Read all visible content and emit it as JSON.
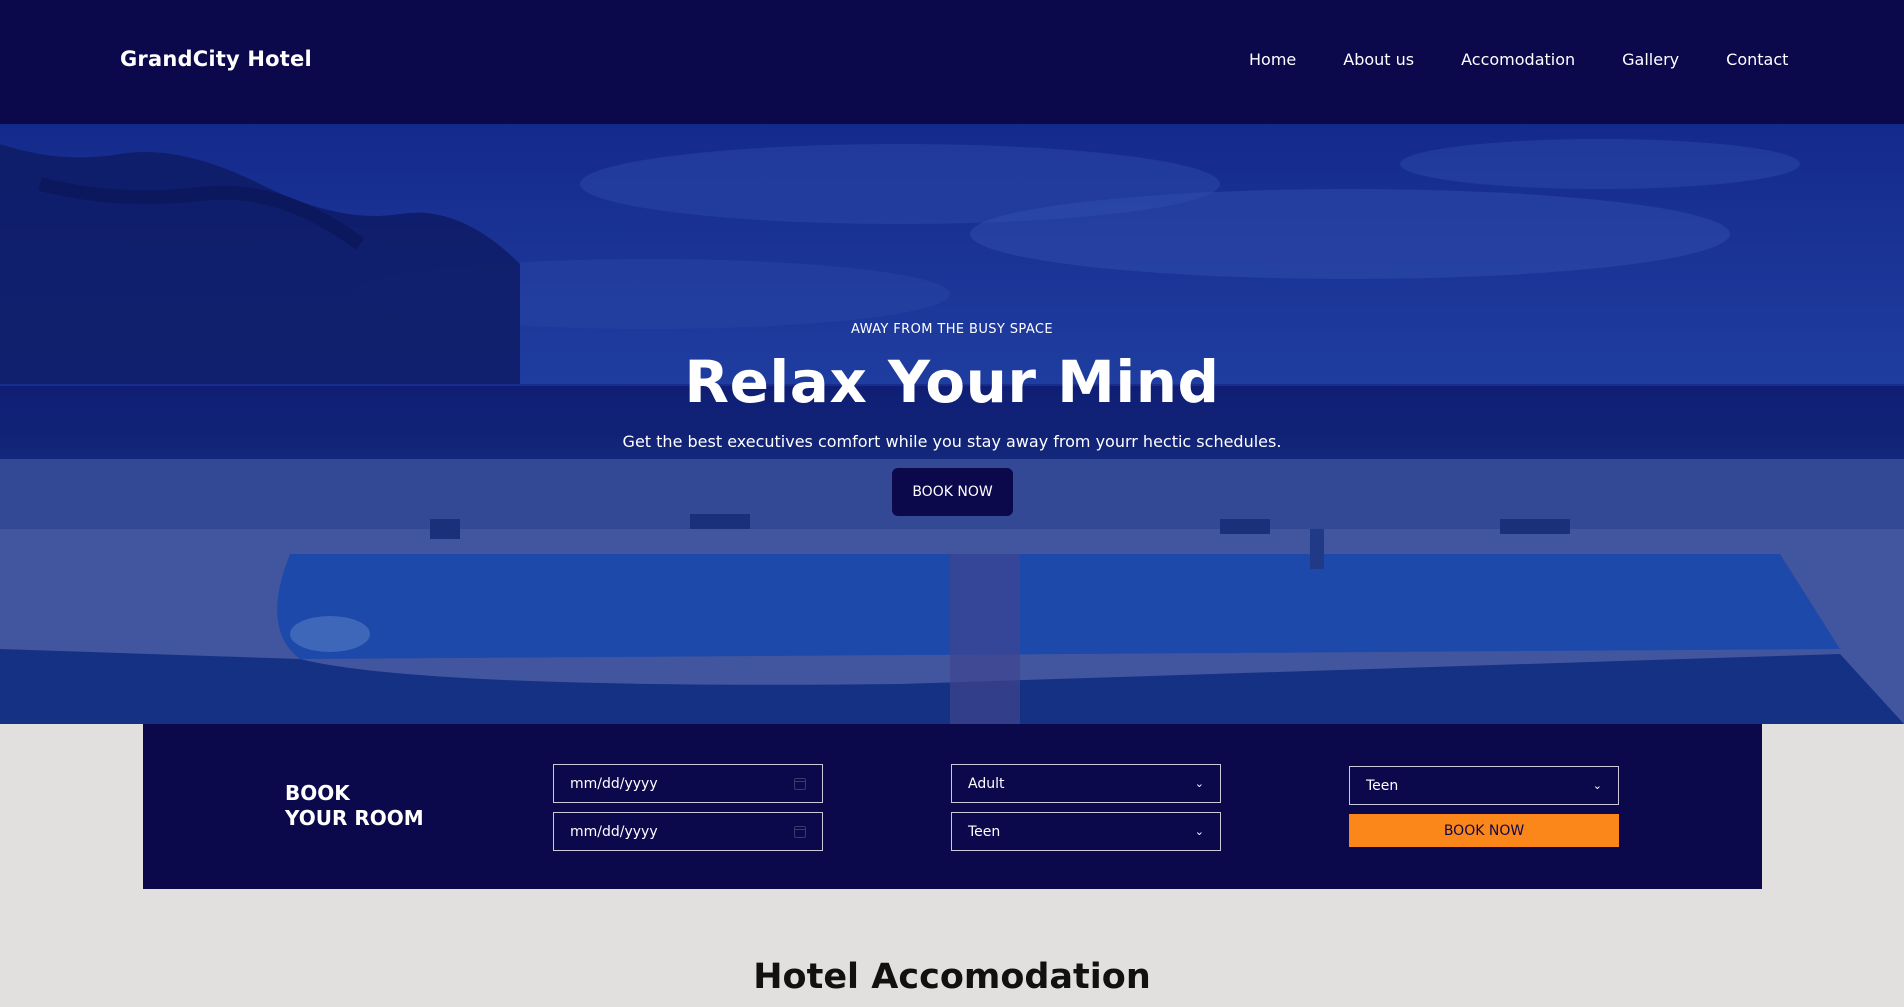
{
  "nav": {
    "brand": "GrandCity Hotel",
    "links": [
      "Home",
      "About us",
      "Accomodation",
      "Gallery",
      "Contact"
    ]
  },
  "hero": {
    "eyebrow": "AWAY FROM THE BUSY SPACE",
    "title": "Relax Your Mind",
    "subtitle": "Get the best executives comfort while you stay away from yourr hectic schedules.",
    "button": "BOOK NOW"
  },
  "booking": {
    "title_line1": "BOOK",
    "title_line2": "YOUR ROOM",
    "checkin_placeholder": "mm/dd/yyyy",
    "checkout_placeholder": "mm/dd/yyyy",
    "adult_select": "Adult",
    "teen_select_1": "Teen",
    "teen_select_2": "Teen",
    "button": "BOOK NOW"
  },
  "section": {
    "title": "Hotel Accomodation"
  },
  "colors": {
    "nav_bg": "#0b084c",
    "accent": "#fb861a",
    "page_bg": "#e2e0df"
  }
}
